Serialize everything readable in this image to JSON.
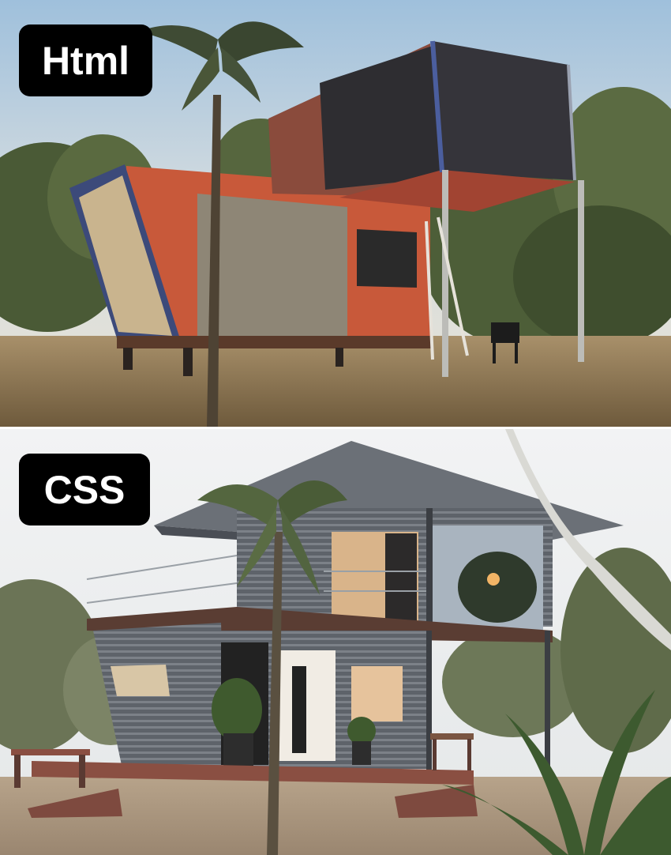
{
  "panels": [
    {
      "label": "Html"
    },
    {
      "label": "CSS"
    }
  ],
  "colors": {
    "label_background": "#000000",
    "label_text": "#ffffff",
    "container_rust": "#c8593a",
    "house_siding": "#5e636a"
  }
}
